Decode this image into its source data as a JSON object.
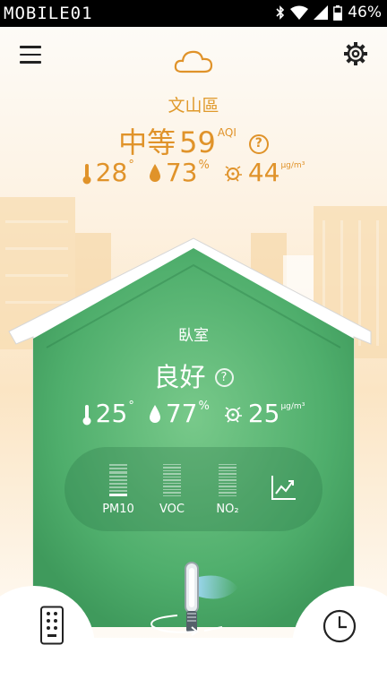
{
  "status_bar": {
    "left_text": "MOBILE01",
    "battery": "46%"
  },
  "header": {
    "location": "文山區",
    "aqi_label": "中等",
    "aqi_value": "59",
    "aqi_unit": "AQI",
    "help": "?"
  },
  "outdoor": {
    "temperature": "28",
    "temperature_unit": "°",
    "humidity": "73",
    "humidity_unit": "%",
    "pm": "44",
    "pm_unit": "μg/m³"
  },
  "room": {
    "name": "臥室",
    "status": "良好",
    "help": "?",
    "temperature": "25",
    "temperature_unit": "°",
    "humidity": "77",
    "humidity_unit": "%",
    "pm": "25",
    "pm_unit": "μg/m³"
  },
  "pollutants": [
    {
      "label": "PM10",
      "level": 1
    },
    {
      "label": "VOC",
      "level": 0
    },
    {
      "label": "NO₂",
      "level": 0
    }
  ],
  "icons": {
    "menu": "menu-icon",
    "settings": "gear-icon",
    "weather": "cloud-icon",
    "chart": "chart-icon",
    "remote": "remote-icon",
    "schedule": "clock-icon",
    "device": "purifier-fan-icon"
  },
  "colors": {
    "accent_orange": "#e0932a",
    "house_green": "#4fae6c",
    "background_peach": "#fbe5c4"
  }
}
